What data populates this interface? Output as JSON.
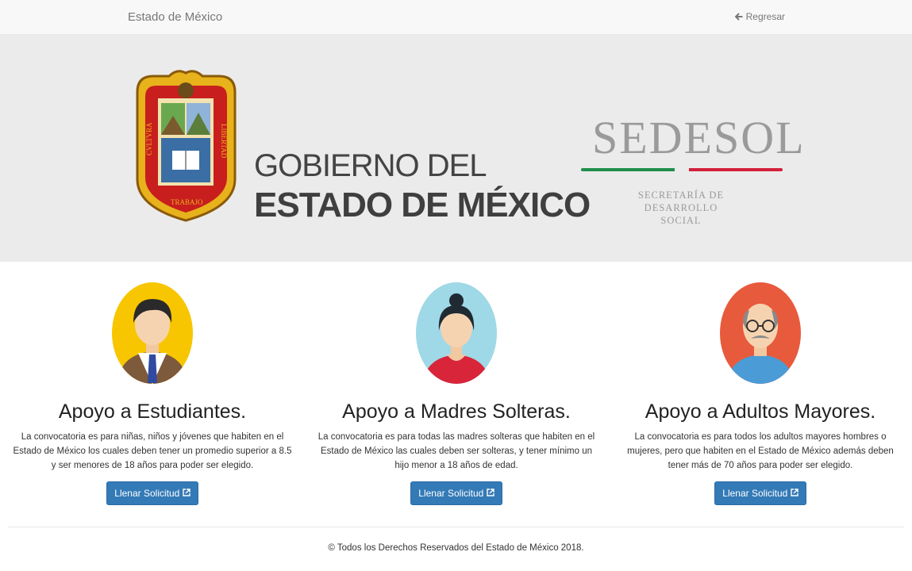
{
  "nav": {
    "brand": "Estado de México",
    "back_label": "Regresar"
  },
  "hero": {
    "gob_line1": "GOBIERNO DEL",
    "gob_line2": "ESTADO DE MÉXICO",
    "seal_left": "CVLTVRA",
    "seal_right": "LIBERTAD",
    "seal_bottom": "TRABAJO",
    "sedesol": "SEDESOL",
    "sedesol_sub1": "SECRETARÍA DE",
    "sedesol_sub2": "DESARROLLO SOCIAL",
    "colors": {
      "green": "#1f8f4c",
      "white": "#ffffff",
      "red": "#d3203b"
    }
  },
  "programs": [
    {
      "title": "Apoyo a Estudiantes.",
      "text": "La convocatoria es para niñas, niños y jóvenes que habiten en el Estado de México los cuales deben tener un promedio superior a 8.5 y ser menores de 18 años para poder ser elegido.",
      "button": "Llenar Solicitud",
      "icon": "student-avatar"
    },
    {
      "title": "Apoyo a Madres Solteras.",
      "text": "La convocatoria es para todas las madres solteras que habiten en el Estado de México las cuales deben ser solteras, y tener mínimo un hijo menor a 18 años de edad.",
      "button": "Llenar Solicitud",
      "icon": "mother-avatar"
    },
    {
      "title": "Apoyo a Adultos Mayores.",
      "text": "La convocatoria es para todos los adultos mayores hombres o mujeres, pero que habiten en el Estado de México además deben tener más de 70 años para poder ser elegido.",
      "button": "Llenar Solicitud",
      "icon": "senior-avatar"
    }
  ],
  "footer": {
    "text": "© Todos los Derechos Reservados del Estado de México 2018."
  },
  "theme": {
    "primary": "#337ab7",
    "nav_bg": "#f8f8f8",
    "hero_bg": "#ebebeb"
  }
}
